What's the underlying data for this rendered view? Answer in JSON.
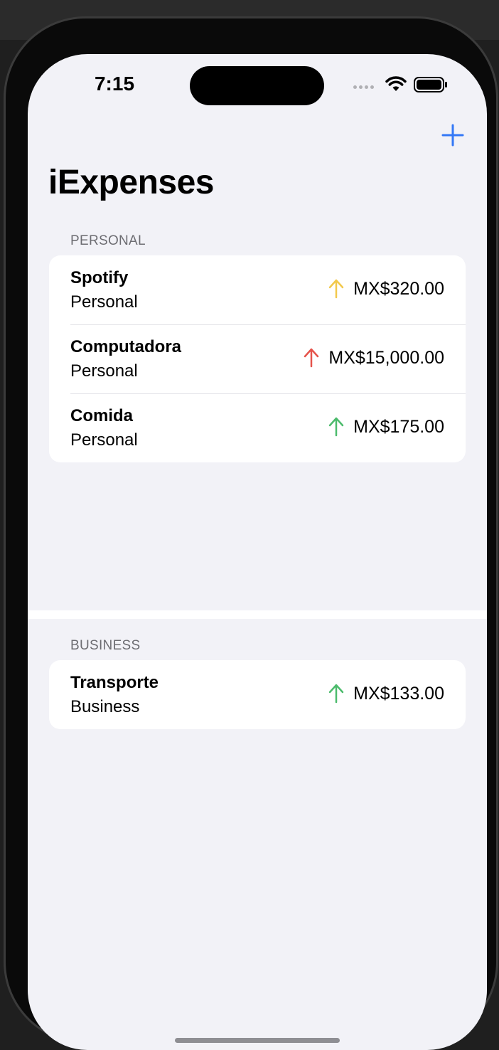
{
  "status_bar": {
    "time": "7:15"
  },
  "nav": {
    "title": "iExpenses",
    "add_icon": "plus-icon",
    "accent_color": "#3478f6"
  },
  "sections": [
    {
      "header": "PERSONAL",
      "items": [
        {
          "name": "Spotify",
          "type": "Personal",
          "amount": "MX$320.00",
          "arrow_icon": "arrow-up-icon",
          "arrow_color": "#f2c94c"
        },
        {
          "name": "Computadora",
          "type": "Personal",
          "amount": "MX$15,000.00",
          "arrow_icon": "arrow-up-icon",
          "arrow_color": "#e5534b"
        },
        {
          "name": "Comida",
          "type": "Personal",
          "amount": "MX$175.00",
          "arrow_icon": "arrow-up-icon",
          "arrow_color": "#4cbb6c"
        }
      ]
    },
    {
      "header": "BUSINESS",
      "items": [
        {
          "name": "Transporte",
          "type": "Business",
          "amount": "MX$133.00",
          "arrow_icon": "arrow-up-icon",
          "arrow_color": "#4cbb6c"
        }
      ]
    }
  ]
}
